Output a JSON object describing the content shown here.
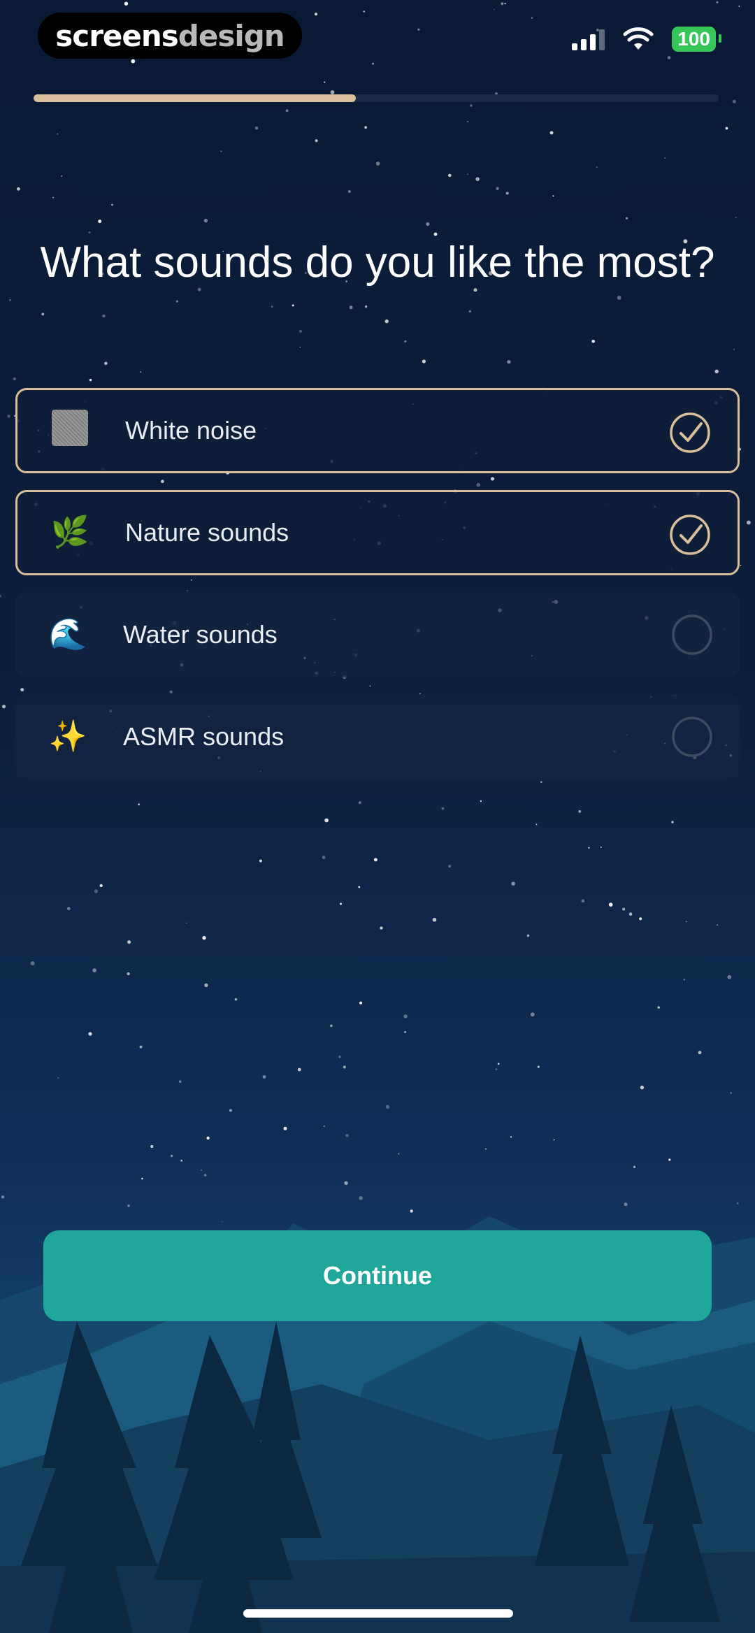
{
  "brand": {
    "part1": "screens",
    "part2": "design"
  },
  "status_bar": {
    "battery": "100",
    "battery_color": "#35c759"
  },
  "progress": {
    "value": 0.47,
    "color": "#d9bf9b"
  },
  "question": "What sounds do you like the most?",
  "options": [
    {
      "label": "White noise",
      "icon": "white-noise-square",
      "selected": true
    },
    {
      "label": "Nature sounds",
      "icon": "🌿",
      "selected": true
    },
    {
      "label": "Water sounds",
      "icon": "🌊",
      "selected": false
    },
    {
      "label": "ASMR sounds",
      "icon": "✨",
      "selected": false
    }
  ],
  "continue_label": "Continue",
  "colors": {
    "accent": "#1ea79a",
    "selection": "#d9bf9b"
  }
}
